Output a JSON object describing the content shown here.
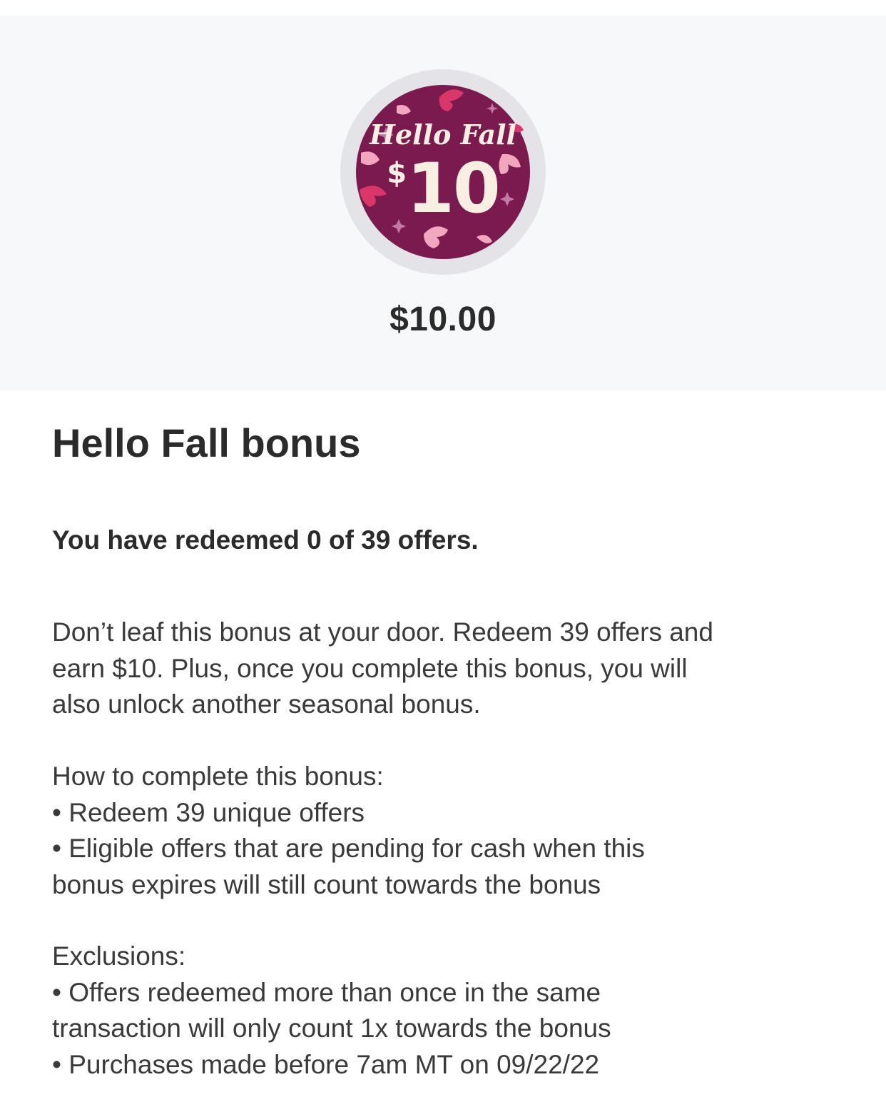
{
  "hero": {
    "badge": {
      "script_text": "Hello Fall",
      "currency": "$",
      "value": "10",
      "colors": {
        "ring": "#e4e4e8",
        "disc": "#7a1a4e",
        "leaf_red": "#d9366a",
        "leaf_pink": "#f2a7bf",
        "text": "#f8efe2"
      }
    },
    "amount": "$10.00",
    "background": "#f7f8fa"
  },
  "bonus": {
    "title": "Hello Fall bonus",
    "progress_text": "You have redeemed 0 of 39 offers.",
    "description_lines": [
      "Don’t leaf this bonus at your door. Redeem 39 offers and",
      "earn $10. Plus, once you complete this bonus, you will",
      "also unlock another seasonal bonus."
    ],
    "how_to_lines": [
      "How to complete this bonus:",
      "• Redeem 39 unique offers",
      "• Eligible offers that are pending for cash when this",
      "bonus expires will still count towards the bonus"
    ],
    "exclusions_lines": [
      "Exclusions:",
      "• Offers redeemed more than once in the same",
      "transaction will only count 1x towards the bonus",
      "• Purchases made before 7am MT on 09/22/22"
    ]
  }
}
